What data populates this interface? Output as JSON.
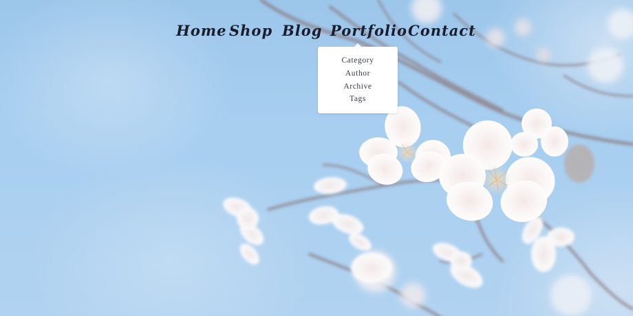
{
  "nav": {
    "items": [
      {
        "label": "Home"
      },
      {
        "label": "Shop"
      },
      {
        "label": "Blog"
      },
      {
        "label": "Portfolio"
      },
      {
        "label": "Contact"
      }
    ],
    "active_dropdown": "Portfolio"
  },
  "dropdown": {
    "items": [
      {
        "label": "Category"
      },
      {
        "label": "Author"
      },
      {
        "label": "Archive"
      },
      {
        "label": "Tags"
      }
    ]
  },
  "background": {
    "description_icon": "cherry-blossom-photo",
    "sky_color": "#9cc8ee",
    "blossom_color": "#f7f1f2",
    "branch_color": "#7a6a6e"
  },
  "colors": {
    "nav_text": "#1b1d2c",
    "dropdown_bg": "#ffffff",
    "dropdown_text": "#333840"
  }
}
